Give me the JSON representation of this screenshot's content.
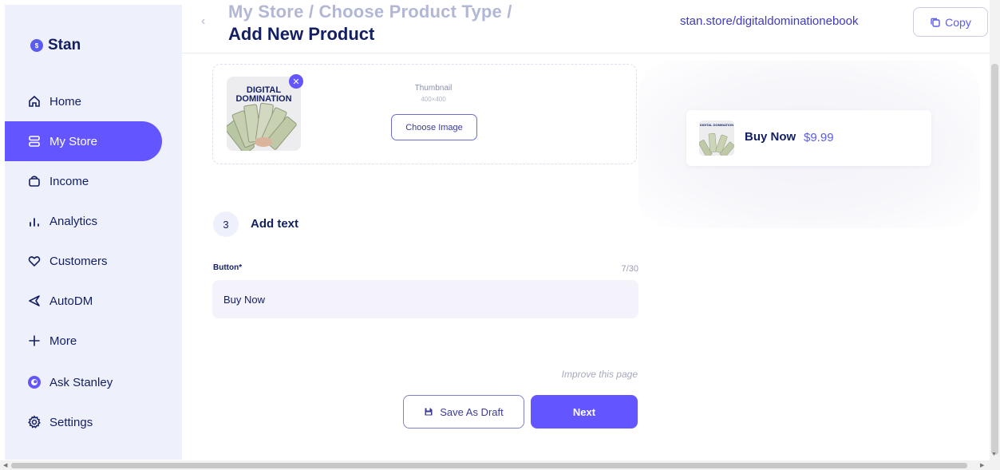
{
  "brand": {
    "name": "Stan",
    "accent": "#6355ff"
  },
  "sidebar": {
    "items": [
      {
        "label": "Home",
        "icon": "home-icon"
      },
      {
        "label": "My Store",
        "icon": "store-icon",
        "active": true
      },
      {
        "label": "Income",
        "icon": "income-icon"
      },
      {
        "label": "Analytics",
        "icon": "analytics-icon"
      },
      {
        "label": "Customers",
        "icon": "heart-icon"
      },
      {
        "label": "AutoDM",
        "icon": "send-icon"
      },
      {
        "label": "More",
        "icon": "plus-icon"
      },
      {
        "label": "Ask Stanley",
        "icon": "stanley-icon"
      },
      {
        "label": "Settings",
        "icon": "gear-icon"
      }
    ]
  },
  "header": {
    "breadcrumb": "My Store / Choose Product Type /",
    "title": "Add New Product",
    "store_url": "stan.store/digitaldominationebook",
    "copy_label": "Copy"
  },
  "thumbnail": {
    "image_text": "DIGITAL DOMINATION",
    "label": "Thumbnail",
    "size_hint": "400×400",
    "choose_label": "Choose Image"
  },
  "step": {
    "number": "3",
    "title": "Add text",
    "field_label": "Button*",
    "field_count": "7/30",
    "field_value": "Buy Now"
  },
  "footer": {
    "improve_link": "Improve this page",
    "save_draft_label": "Save As Draft",
    "next_label": "Next"
  },
  "preview": {
    "thumb_text": "DIGITAL DOMINATION",
    "button_text": "Buy Now",
    "price": "$9.99"
  }
}
